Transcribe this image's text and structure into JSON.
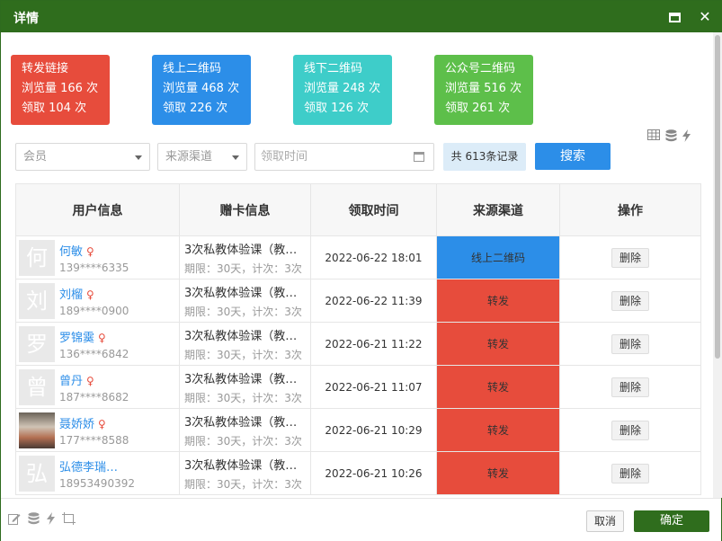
{
  "dialog": {
    "title": "详情"
  },
  "stats": [
    {
      "title": "转发链接",
      "views": "浏览量 166 次",
      "claims": "领取 104 次",
      "color": "#e74c3c"
    },
    {
      "title": "线上二维码",
      "views": "浏览量 468 次",
      "claims": "领取 226 次",
      "color": "#2c8ee8"
    },
    {
      "title": "线下二维码",
      "views": "浏览量 248 次",
      "claims": "领取 126 次",
      "color": "#3ecdc9"
    },
    {
      "title": "公众号二维码",
      "views": "浏览量 516 次",
      "claims": "领取 261 次",
      "color": "#5dbf4a"
    }
  ],
  "filters": {
    "member_placeholder": "会员",
    "source_placeholder": "来源渠道",
    "date_placeholder": "领取时间",
    "record_count": "共 613条记录",
    "search_label": "搜索"
  },
  "table": {
    "headers": [
      "用户信息",
      "赠卡信息",
      "领取时间",
      "来源渠道",
      "操作"
    ],
    "rows": [
      {
        "avatar": "何",
        "name": "何敏",
        "gender": "♀",
        "phone": "139****6335",
        "card": "3次私教体验课（教…",
        "terms": "期限：30天，计次：3次",
        "time": "2022-06-22 18:01",
        "source": "线上二维码",
        "action": "删除"
      },
      {
        "avatar": "刘",
        "name": "刘榴",
        "gender": "♀",
        "phone": "189****0900",
        "card": "3次私教体验课（教…",
        "terms": "期限：30天，计次：3次",
        "time": "2022-06-22 11:39",
        "source": "转发",
        "action": "删除"
      },
      {
        "avatar": "罗",
        "name": "罗锦霙",
        "gender": "♀",
        "phone": "136****6842",
        "card": "3次私教体验课（教…",
        "terms": "期限：30天，计次：3次",
        "time": "2022-06-21 11:22",
        "source": "转发",
        "action": "删除"
      },
      {
        "avatar": "曾",
        "name": "曾丹",
        "gender": "♀",
        "phone": "187****8682",
        "card": "3次私教体验课（教…",
        "terms": "期限：30天，计次：3次",
        "time": "2022-06-21 11:07",
        "source": "转发",
        "action": "删除"
      },
      {
        "avatar": "",
        "name": "聂娇娇",
        "gender": "♀",
        "phone": "177****8588",
        "card": "3次私教体验课（教…",
        "terms": "期限：30天，计次：3次",
        "time": "2022-06-21 10:29",
        "source": "转发",
        "action": "删除"
      },
      {
        "avatar": "弘",
        "name": "弘德李瑞…",
        "gender": "",
        "phone": "18953490392",
        "card": "3次私教体验课（教…",
        "terms": "期限：30天，计次：3次",
        "time": "2022-06-21 10:26",
        "source": "转发",
        "action": "删除"
      }
    ]
  },
  "footer": {
    "cancel_label": "取消",
    "ok_label": "确定"
  },
  "colors": {
    "titlebar": "#2f6d1d",
    "primary": "#2c8ee8",
    "danger": "#e74c3c"
  },
  "icons": [
    "maximize-icon",
    "close-icon",
    "grid-icon",
    "database-icon",
    "lightning-icon",
    "edit-icon",
    "screenshot-icon"
  ]
}
